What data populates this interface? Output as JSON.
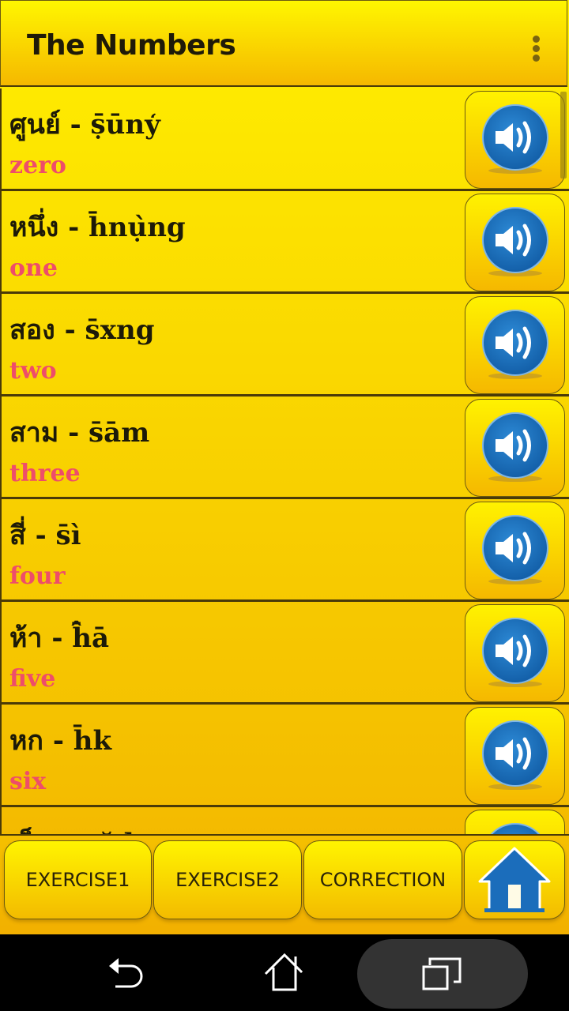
{
  "app_bar": {
    "title": "The Numbers",
    "menu_icon": "more-vert-icon"
  },
  "colors": {
    "background_top": "#ffef00",
    "background_bottom": "#f2b400",
    "thai_text": "#1d1a08",
    "english_text": "#ee4d6a",
    "sound_icon": "#1a6fba",
    "divider": "#4a3a08"
  },
  "list": {
    "items": [
      {
        "thai": "ศูนย์ - ṣ̄ūny̒",
        "english": "zero",
        "icon": "speaker-icon"
      },
      {
        "thai": "หนึ่ง - h̄nụ̀ng",
        "english": "one",
        "icon": "speaker-icon"
      },
      {
        "thai": "สอง - s̄xng",
        "english": "two",
        "icon": "speaker-icon"
      },
      {
        "thai": "สาม - s̄ām",
        "english": "three",
        "icon": "speaker-icon"
      },
      {
        "thai": "สี่ - s̄ì",
        "english": "four",
        "icon": "speaker-icon"
      },
      {
        "thai": "ห้า - h̄̂ā",
        "english": "five",
        "icon": "speaker-icon"
      },
      {
        "thai": "หก - h̄k",
        "english": "six",
        "icon": "speaker-icon"
      },
      {
        "thai": "เจ็ด - cĕd",
        "english": "",
        "icon": "speaker-icon"
      }
    ]
  },
  "bottom_bar": {
    "exercise1": "EXERCISE1",
    "exercise2": "EXERCISE2",
    "correction": "CORRECTION",
    "home_icon": "home-icon"
  },
  "system_nav": {
    "back_icon": "back-icon",
    "home_icon": "home-icon",
    "recents_icon": "recents-icon"
  }
}
